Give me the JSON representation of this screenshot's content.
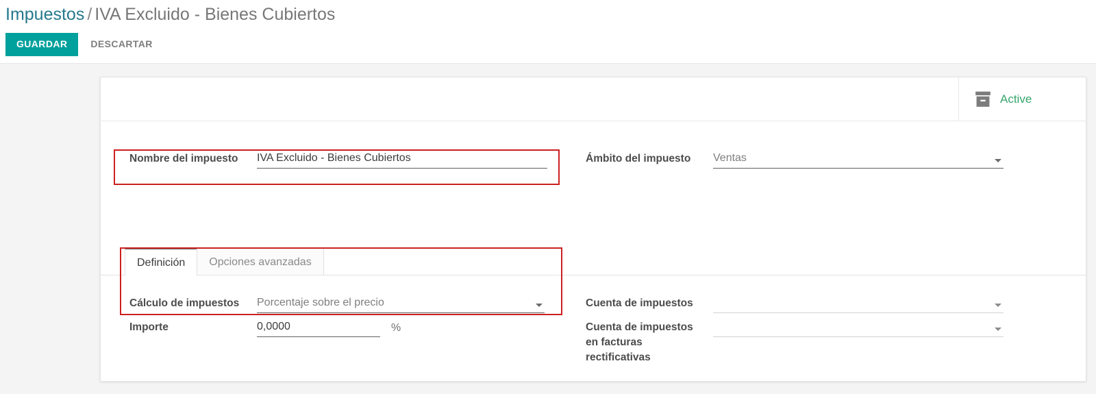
{
  "breadcrumb": {
    "root": "Impuestos",
    "separator": "/",
    "current": "IVA Excluido - Bienes Cubiertos"
  },
  "actions": {
    "save_label": "GUARDAR",
    "discard_label": "DESCARTAR"
  },
  "status": {
    "label": "Active",
    "icon": "archive-box-icon",
    "color": "#36a56c"
  },
  "fields": {
    "tax_name": {
      "label": "Nombre del impuesto",
      "value": "IVA Excluido -  Bienes Cubiertos"
    },
    "tax_scope": {
      "label": "Ámbito del impuesto",
      "value": "Ventas"
    },
    "tax_computation": {
      "label": "Cálculo de impuestos",
      "value": "Porcentaje sobre el precio"
    },
    "amount": {
      "label": "Importe",
      "value": "0,0000",
      "suffix": "%"
    },
    "tax_account": {
      "label": "Cuenta de impuestos",
      "value": ""
    },
    "tax_account_refund": {
      "label": "Cuenta de impuestos en facturas rectificativas",
      "line1": "Cuenta de impuestos",
      "line2": "en facturas",
      "line3": "rectificativas",
      "value": ""
    }
  },
  "tabs": [
    {
      "label": "Definición",
      "active": true
    },
    {
      "label": "Opciones avanzadas",
      "active": false
    }
  ],
  "annotations": {
    "highlight_color": "#cc1f1f",
    "boxes": [
      {
        "name": "tax-name-highlight"
      },
      {
        "name": "tax-computation-highlight"
      }
    ]
  },
  "theme": {
    "primary": "#00a09d",
    "link": "#26798c",
    "page_bg": "#f4f4f4"
  }
}
